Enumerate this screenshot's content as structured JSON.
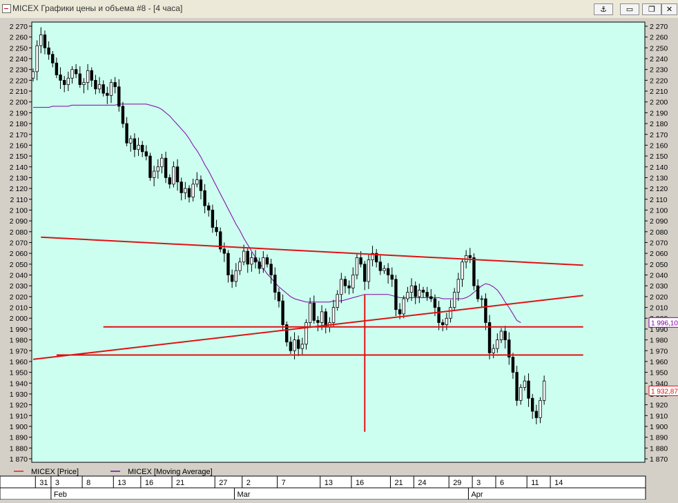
{
  "window": {
    "title": "MICEX Графики цены и объема #8 - [4 часа]",
    "buttons": {
      "anchor": "⚓",
      "minimize": "▭",
      "restore": "❐",
      "close": "✕"
    }
  },
  "chart_data": {
    "type": "candlestick",
    "ylim": [
      1865,
      2275
    ],
    "y_ticks": [
      "2 270",
      "2 260",
      "2 250",
      "2 240",
      "2 230",
      "2 220",
      "2 210",
      "2 200",
      "2 190",
      "2 180",
      "2 170",
      "2 160",
      "2 150",
      "2 140",
      "2 130",
      "2 120",
      "2 110",
      "2 100",
      "2 090",
      "2 080",
      "2 070",
      "2 060",
      "2 050",
      "2 040",
      "2 030",
      "2 020",
      "2 010",
      "2 000",
      "1 990",
      "1 980",
      "1 970",
      "1 960",
      "1 950",
      "1 940",
      "1 930",
      "1 920",
      "1 910",
      "1 900",
      "1 890",
      "1 880",
      "1 870"
    ],
    "x_day_labels": [
      "31",
      "3",
      "8",
      "13",
      "16",
      "21",
      "27",
      "2",
      "7",
      "13",
      "16",
      "21",
      "24",
      "29",
      "3",
      "6",
      "11",
      "14"
    ],
    "x_month_labels": [
      "Feb",
      "Mar",
      "Apr"
    ],
    "price_labels": {
      "moving_average_last": "1 996,10",
      "price_last": "1 932,87"
    },
    "legend": [
      {
        "name": "MICEX [Price]",
        "color": "#e02020"
      },
      {
        "name": "MICEX [Moving Average]",
        "color": "#8000a0"
      }
    ],
    "series_price_close": [
      2228,
      2252,
      2262,
      2250,
      2244,
      2236,
      2225,
      2220,
      2216,
      2222,
      2230,
      2226,
      2216,
      2218,
      2229,
      2220,
      2212,
      2216,
      2208,
      2206,
      2218,
      2214,
      2196,
      2180,
      2162,
      2166,
      2156,
      2160,
      2154,
      2150,
      2130,
      2136,
      2140,
      2148,
      2130,
      2124,
      2140,
      2126,
      2116,
      2120,
      2112,
      2124,
      2128,
      2118,
      2104,
      2100,
      2084,
      2080,
      2064,
      2060,
      2040,
      2034,
      2044,
      2052,
      2062,
      2050,
      2056,
      2052,
      2046,
      2056,
      2050,
      2040,
      2024,
      2016,
      1994,
      1978,
      1970,
      1980,
      1972,
      1976,
      1996,
      2014,
      1998,
      1996,
      2006,
      1992,
      1996,
      2010,
      2022,
      2036,
      2030,
      2028,
      2040,
      2056,
      2050,
      2034,
      2054,
      2060,
      2052,
      2044,
      2046,
      2040,
      2036,
      2008,
      2004,
      2018,
      2024,
      2030,
      2020,
      2026,
      2024,
      2020,
      2018,
      2010,
      1996,
      1994,
      2000,
      2010,
      2024,
      2036,
      2052,
      2058,
      2056,
      2030,
      2018,
      2018,
      1996,
      1968,
      1972,
      1980,
      1988,
      1980,
      1964,
      1950,
      1924,
      1936,
      1942,
      1926,
      1914,
      1908,
      1924,
      1942
    ],
    "series_moving_average": [
      2195,
      2195,
      2195,
      2195,
      2195,
      2196,
      2196,
      2196,
      2196,
      2196,
      2197,
      2197,
      2197,
      2197,
      2197,
      2197,
      2197,
      2197,
      2197,
      2197,
      2197,
      2197,
      2198,
      2198,
      2198,
      2198,
      2198,
      2198,
      2198,
      2198,
      2197,
      2196,
      2195,
      2193,
      2190,
      2187,
      2183,
      2179,
      2175,
      2171,
      2166,
      2160,
      2155,
      2149,
      2142,
      2136,
      2129,
      2122,
      2115,
      2108,
      2101,
      2094,
      2087,
      2081,
      2074,
      2068,
      2062,
      2056,
      2051,
      2046,
      2041,
      2037,
      2033,
      2029,
      2026,
      2023,
      2020,
      2018,
      2017,
      2016,
      2015,
      2015,
      2015,
      2015,
      2015,
      2015,
      2015,
      2016,
      2016,
      2016,
      2017,
      2018,
      2019,
      2020,
      2021,
      2022,
      2022,
      2022,
      2022,
      2022,
      2022,
      2022,
      2021,
      2020,
      2019,
      2019,
      2019,
      2019,
      2019,
      2019,
      2019,
      2019,
      2019,
      2019,
      2019,
      2018,
      2018,
      2018,
      2018,
      2018,
      2018,
      2019,
      2021,
      2024,
      2027,
      2030,
      2032,
      2031,
      2029,
      2026,
      2021,
      2015,
      2010,
      2004,
      1998,
      1996
    ]
  },
  "annotations": {
    "lines": [
      {
        "from": [
          2,
          2075
        ],
        "to": [
          141,
          2049
        ]
      },
      {
        "from": [
          0,
          1962
        ],
        "to": [
          141,
          2021
        ]
      },
      {
        "from": [
          18,
          1992
        ],
        "to": [
          141,
          1992
        ]
      },
      {
        "from": [
          6,
          1966
        ],
        "to": [
          141,
          1966
        ]
      },
      {
        "from": [
          85,
          2022
        ],
        "to": [
          85,
          1895
        ]
      }
    ]
  }
}
